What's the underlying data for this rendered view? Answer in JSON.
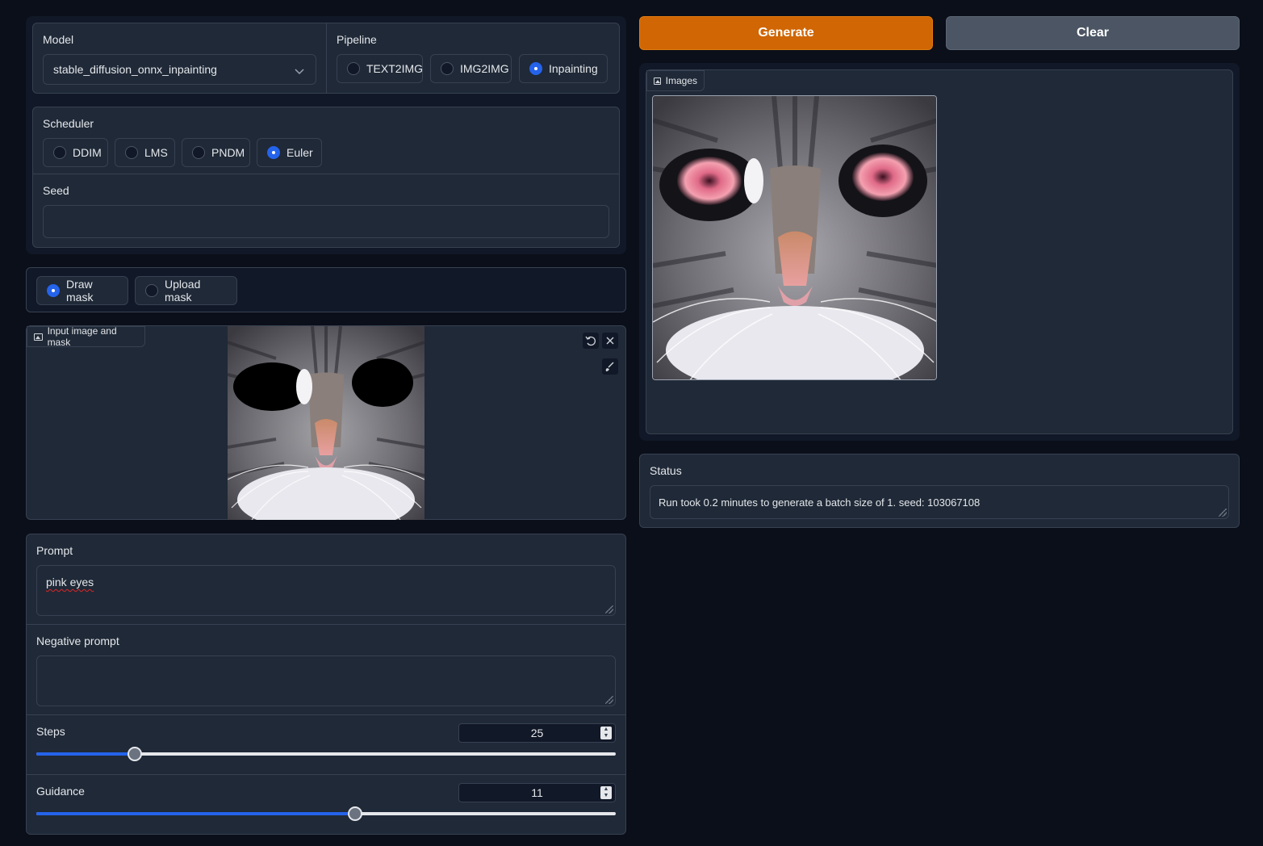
{
  "model": {
    "label": "Model",
    "value": "stable_diffusion_onnx_inpainting"
  },
  "pipeline": {
    "label": "Pipeline",
    "options": [
      "TEXT2IMG",
      "IMG2IMG",
      "Inpainting"
    ],
    "selected": "Inpainting"
  },
  "scheduler": {
    "label": "Scheduler",
    "options": [
      "DDIM",
      "LMS",
      "PNDM",
      "Euler"
    ],
    "selected": "Euler"
  },
  "seed": {
    "label": "Seed",
    "value": ""
  },
  "mask_mode": {
    "options": [
      "Draw mask",
      "Upload mask"
    ],
    "selected": "Draw mask"
  },
  "input_image": {
    "label": "Input image and mask"
  },
  "prompt": {
    "label": "Prompt",
    "value": "pink eyes"
  },
  "negative_prompt": {
    "label": "Negative prompt",
    "value": ""
  },
  "steps": {
    "label": "Steps",
    "value": "25",
    "fraction": 0.17
  },
  "guidance": {
    "label": "Guidance",
    "value": "11",
    "fraction": 0.55
  },
  "actions": {
    "generate": "Generate",
    "clear": "Clear"
  },
  "gallery": {
    "label": "Images"
  },
  "status": {
    "label": "Status",
    "value": "Run took 0.2 minutes to generate a batch size of 1. seed: 103067108"
  },
  "colors": {
    "accent": "#2563eb",
    "generate": "#d97706",
    "clear": "#4b5563",
    "background": "#0b0f19"
  }
}
